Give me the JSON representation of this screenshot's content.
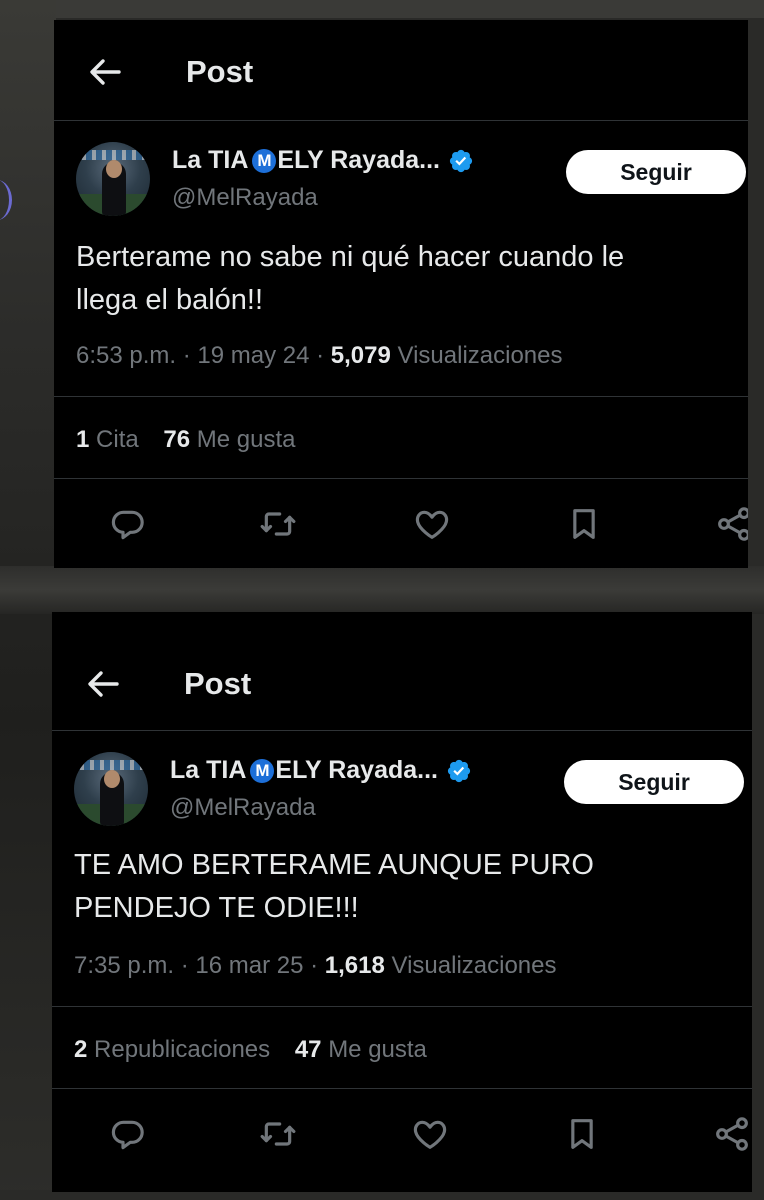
{
  "posts": [
    {
      "header_title": "Post",
      "display_name_prefix": "La TIA",
      "badge_letter": "M",
      "display_name_suffix": "ELY Rayada...",
      "handle": "@MelRayada",
      "follow_label": "Seguir",
      "text_lines": [
        "Berterame no sabe ni qué hacer cuando le",
        "llega el balón!!"
      ],
      "time": "6:53 p.m. · 19 may 24 · ",
      "views_count": "5,079",
      "views_label": "Visualizaciones",
      "stat1_count": "1",
      "stat1_label": "Cita",
      "stat2_count": "76",
      "stat2_label": "Me gusta"
    },
    {
      "header_title": "Post",
      "display_name_prefix": "La TIA",
      "badge_letter": "M",
      "display_name_suffix": "ELY Rayada...",
      "handle": "@MelRayada",
      "follow_label": "Seguir",
      "text_lines": [
        "TE AMO BERTERAME AUNQUE PURO",
        "PENDEJO TE ODIE!!!"
      ],
      "time": "7:35 p.m. · 16 mar 25 · ",
      "views_count": "1,618",
      "views_label": "Visualizaciones",
      "stat1_count": "2",
      "stat1_label": "Republicaciones",
      "stat2_count": "47",
      "stat2_label": "Me gusta"
    }
  ],
  "icons": [
    "back-arrow-icon",
    "verified-badge-icon",
    "reply-icon",
    "repost-icon",
    "like-icon",
    "bookmark-icon",
    "share-icon"
  ],
  "colors": {
    "background": "#000000",
    "text": "#e7e9ea",
    "muted": "#71767b",
    "verified": "#1d9bf0",
    "badge": "#1d6fd8",
    "follow_button_bg": "#ffffff"
  }
}
